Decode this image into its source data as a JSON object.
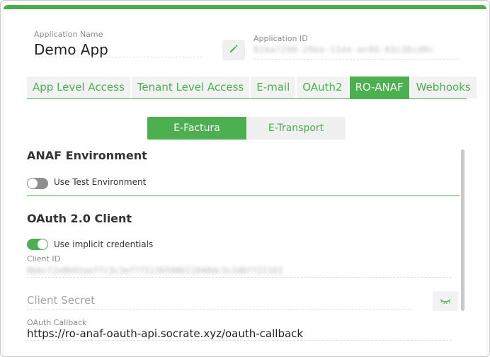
{
  "app": {
    "name_label": "Application Name",
    "name_value": "Demo App",
    "id_label": "Application ID",
    "id_value": "81Aa7290-29ee-11ee-ac0d-03c38cd0c"
  },
  "tabs": [
    {
      "label": "App Level Access"
    },
    {
      "label": "Tenant Level Access"
    },
    {
      "label": "E-mail"
    },
    {
      "label": "OAuth2"
    },
    {
      "label": "RO-ANAF",
      "active": true
    },
    {
      "label": "Webhooks"
    }
  ],
  "subtabs": {
    "left": "E-Factura",
    "right": "E-Transport"
  },
  "anaf_env": {
    "title": "ANAF Environment",
    "toggle_label": "Use Test Environment",
    "toggle_on": false
  },
  "oauth_client": {
    "title": "OAuth 2.0 Client",
    "toggle_label": "Use implicit credentials",
    "toggle_on": true,
    "client_id_label": "Client ID",
    "client_id_value": "8bbcf2e8b92aeffc3c3ef7f5136590611848dc3c2dbff21163",
    "client_secret_placeholder": "Client Secret",
    "callback_label": "OAuth Callback",
    "callback_value": "https://ro-anaf-oauth-api.socrate.xyz/oauth-callback"
  },
  "colors": {
    "accent": "#4caf50",
    "tab_bg": "#f2f2f2",
    "toggle_off": "#8f8f8f"
  },
  "icons": {
    "edit": "pencil-icon",
    "secret_visibility": "eye-closed-icon"
  }
}
